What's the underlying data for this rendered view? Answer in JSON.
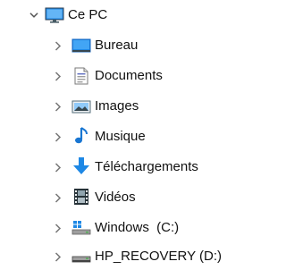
{
  "tree": {
    "root": {
      "label": "Ce PC",
      "icon": "monitor-icon",
      "expanded": true
    },
    "items": [
      {
        "label": "Bureau",
        "icon": "desktop-folder-icon",
        "expanded": false
      },
      {
        "label": "Documents",
        "icon": "documents-icon",
        "expanded": false
      },
      {
        "label": "Images",
        "icon": "pictures-icon",
        "expanded": false
      },
      {
        "label": "Musique",
        "icon": "music-note-icon",
        "expanded": false
      },
      {
        "label": "Téléchargements",
        "icon": "download-arrow-icon",
        "expanded": false
      },
      {
        "label": "Vidéos",
        "icon": "film-strip-icon",
        "expanded": false
      },
      {
        "label": "Windows  (C:)",
        "icon": "windows-drive-icon",
        "expanded": false
      },
      {
        "label": "HP_RECOVERY (D:)",
        "icon": "drive-icon",
        "expanded": false
      }
    ]
  },
  "colors": {
    "chevron": "#606060",
    "text": "#111111",
    "accent_blue": "#1e88e5",
    "music_blue": "#1976d2"
  }
}
